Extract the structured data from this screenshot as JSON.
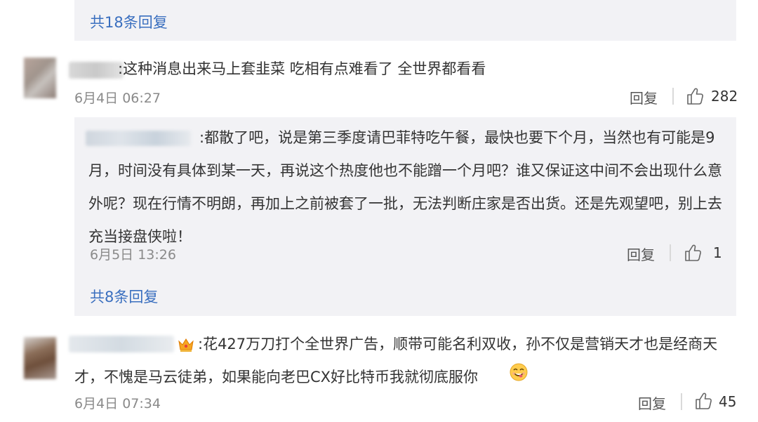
{
  "thread_top": {
    "more_replies": "共18条回复"
  },
  "comment1": {
    "text": ":这种消息出来马上套韭菜 吃相有点难看了 全世界都看看",
    "date": "6月4日 06:27",
    "reply_label": "回复",
    "likes": "282",
    "reply": {
      "text": ":都散了吧，说是第三季度请巴菲特吃午餐，最快也要下个月，当然也有可能是9月，时间没有具体到某一天，再说这个热度他也不能蹭一个月吧？谁又保证这中间不会出现什么意外呢？现在行情不明朗，再加上之前被套了一批，无法判断庄家是否出货。还是先观望吧，别上去充当接盘侠啦！",
      "date": "6月5日 13:26",
      "reply_label": "回复",
      "likes": "1"
    },
    "more_replies": "共8条回复"
  },
  "comment2": {
    "text": ":花427万刀打个全世界广告，顺带可能名利双收，孙不仅是营销天才也是经商天才，不愧是马云徒弟，如果能向老巴CX好比特币我就彻底服你",
    "date": "6月4日 07:34",
    "reply_label": "回复",
    "likes": "45"
  },
  "icons": {
    "like": "thumbs-up-outline-icon",
    "badge": "crown-badge-icon",
    "emoji": "yummy-face-emoji-icon"
  },
  "colors": {
    "link": "#3a6fbf",
    "panel": "#f2f2f5",
    "date": "#8a8a8a"
  }
}
